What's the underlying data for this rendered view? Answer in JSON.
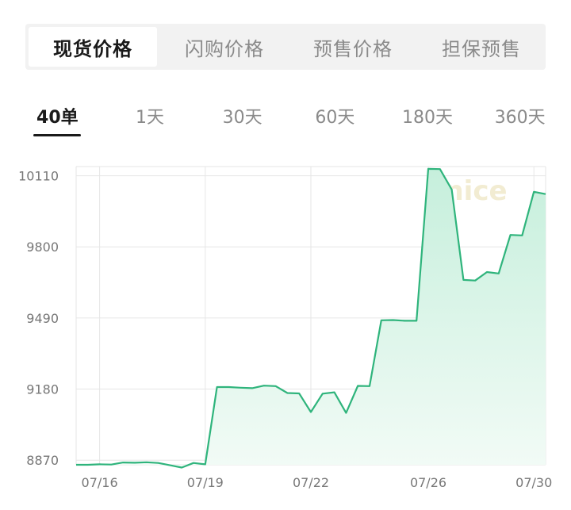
{
  "tabs": [
    {
      "label": "现货价格",
      "active": true
    },
    {
      "label": "闪购价格",
      "active": false
    },
    {
      "label": "预售价格",
      "active": false
    },
    {
      "label": "担保预售",
      "active": false
    }
  ],
  "ranges": [
    {
      "label": "40单",
      "active": true
    },
    {
      "label": "1天",
      "active": false
    },
    {
      "label": "30天",
      "active": false
    },
    {
      "label": "60天",
      "active": false
    },
    {
      "label": "180天",
      "active": false
    },
    {
      "label": "360天",
      "active": false
    }
  ],
  "watermark": "nice",
  "colors": {
    "line": "#2fb47c",
    "fill_top": "#c6efdc",
    "fill_bottom": "#f2fbf6",
    "grid": "#e6e6e6"
  },
  "chart_data": {
    "type": "area",
    "y_ticks": [
      8870,
      9180,
      9490,
      9800,
      10110
    ],
    "ylim": [
      8850,
      10150
    ],
    "x_ticks": [
      {
        "label": "07/16",
        "x": 2
      },
      {
        "label": "07/19",
        "x": 11
      },
      {
        "label": "07/22",
        "x": 20
      },
      {
        "label": "07/26",
        "x": 30
      },
      {
        "label": "07/30",
        "x": 39
      }
    ],
    "x_range": [
      0,
      40
    ],
    "values": [
      8850,
      8850,
      8852,
      8851,
      8860,
      8859,
      8861,
      8858,
      8848,
      8838,
      8858,
      8852,
      9189,
      9189,
      9186,
      9184,
      9195,
      9193,
      9163,
      9161,
      9080,
      9160,
      9166,
      9076,
      9194,
      9193,
      9480,
      9481,
      9478,
      9478,
      10140,
      10139,
      10050,
      9656,
      9653,
      9690,
      9684,
      9852,
      9850,
      10040,
      10030
    ]
  }
}
